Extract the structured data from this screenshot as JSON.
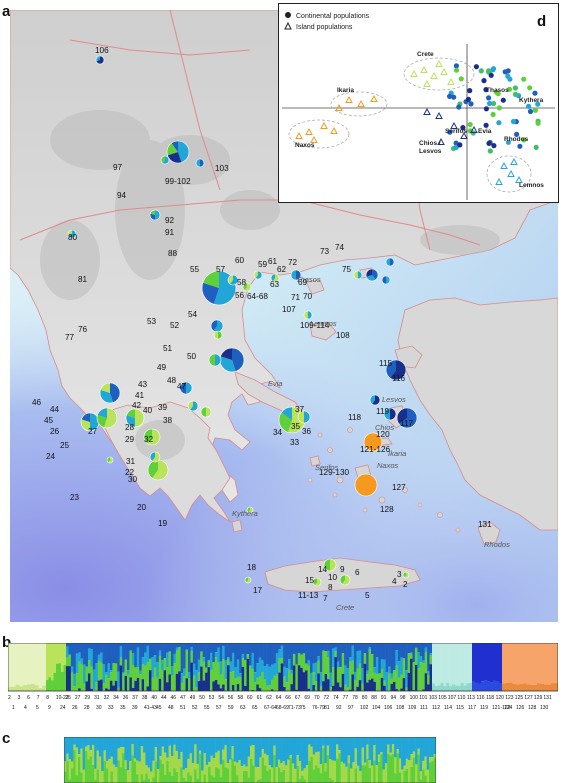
{
  "panels": {
    "a": "a",
    "b": "b",
    "c": "c",
    "d": "d"
  },
  "colors": {
    "sea_deep": "#7f8fe0",
    "sea_light": "#cde9f6",
    "land": "#dedede",
    "border": "#e08a8a",
    "blue": "#1f5fbf",
    "navy": "#1a2f8a",
    "cyan": "#22a6d8",
    "green": "#5fcf3a",
    "lime": "#b8e35a",
    "orange": "#f59a1e",
    "teal": "#7fd6c8"
  },
  "inset": {
    "legend_continental": "Continental populations",
    "legend_island": "Island populations",
    "labels": [
      "Crete",
      "Ikaria",
      "Naxos",
      "Thasos",
      "Kythera",
      "Serifos",
      "Evia",
      "Chios /",
      "Lesvos",
      "Rhodos",
      "Lemnos"
    ]
  },
  "map_labels": {
    "pop_numbers": [
      {
        "t": "106"
      },
      {
        "t": "97"
      },
      {
        "t": "99-102"
      },
      {
        "t": "103"
      },
      {
        "t": "94"
      },
      {
        "t": "92"
      },
      {
        "t": "91"
      },
      {
        "t": "88"
      },
      {
        "t": "80"
      },
      {
        "t": "81"
      },
      {
        "t": "77"
      },
      {
        "t": "76"
      },
      {
        "t": "46"
      },
      {
        "t": "45"
      },
      {
        "t": "44"
      },
      {
        "t": "26"
      },
      {
        "t": "27"
      },
      {
        "t": "25"
      },
      {
        "t": "24"
      },
      {
        "t": "23"
      },
      {
        "t": "28"
      },
      {
        "t": "29"
      },
      {
        "t": "32"
      },
      {
        "t": "22"
      },
      {
        "t": "31"
      },
      {
        "t": "30"
      },
      {
        "t": "20"
      },
      {
        "t": "19"
      },
      {
        "t": "43"
      },
      {
        "t": "42"
      },
      {
        "t": "41"
      },
      {
        "t": "40"
      },
      {
        "t": "39"
      },
      {
        "t": "38"
      },
      {
        "t": "47"
      },
      {
        "t": "48"
      },
      {
        "t": "49"
      },
      {
        "t": "50"
      },
      {
        "t": "51"
      },
      {
        "t": "52"
      },
      {
        "t": "53"
      },
      {
        "t": "54"
      },
      {
        "t": "55"
      },
      {
        "t": "56"
      },
      {
        "t": "57"
      },
      {
        "t": "58"
      },
      {
        "t": "59"
      },
      {
        "t": "60"
      },
      {
        "t": "61"
      },
      {
        "t": "62"
      },
      {
        "t": "63"
      },
      {
        "t": "64-68"
      },
      {
        "t": "69"
      },
      {
        "t": "70"
      },
      {
        "t": "71"
      },
      {
        "t": "72"
      },
      {
        "t": "73"
      },
      {
        "t": "74"
      },
      {
        "t": "75"
      },
      {
        "t": "107"
      },
      {
        "t": "108"
      },
      {
        "t": "109-114"
      },
      {
        "t": "115"
      },
      {
        "t": "116"
      },
      {
        "t": "117"
      },
      {
        "t": "118"
      },
      {
        "t": "119"
      },
      {
        "t": "120"
      },
      {
        "t": "121-126"
      },
      {
        "t": "127"
      },
      {
        "t": "128"
      },
      {
        "t": "129-130"
      },
      {
        "t": "131"
      },
      {
        "t": "37"
      },
      {
        "t": "34"
      },
      {
        "t": "35"
      },
      {
        "t": "36"
      },
      {
        "t": "33"
      },
      {
        "t": "18"
      },
      {
        "t": "17"
      },
      {
        "t": "14"
      },
      {
        "t": "15"
      },
      {
        "t": "10"
      },
      {
        "t": "9"
      },
      {
        "t": "8"
      },
      {
        "t": "7"
      },
      {
        "t": "6"
      },
      {
        "t": "11-13"
      },
      {
        "t": "5"
      },
      {
        "t": "3"
      },
      {
        "t": "2"
      },
      {
        "t": "4"
      }
    ],
    "place_names": [
      {
        "t": "Thasos"
      },
      {
        "t": "Lemnos"
      },
      {
        "t": "Lesvos"
      },
      {
        "t": "Evia"
      },
      {
        "t": "Chios"
      },
      {
        "t": "Ikaria"
      },
      {
        "t": "Serifos"
      },
      {
        "t": "Naxos"
      },
      {
        "t": "Kythera"
      },
      {
        "t": "Rhodos"
      },
      {
        "t": "Crete"
      }
    ]
  },
  "strip_b_labels": {
    "top": [
      "2",
      "3",
      "6",
      "7",
      "8",
      "10-23",
      "25",
      "27",
      "29",
      "31",
      "32",
      "34",
      "36",
      "37",
      "38",
      "40",
      "44",
      "46",
      "47",
      "49",
      "50",
      "53",
      "54",
      "56",
      "58",
      "60",
      "61",
      "62",
      "64",
      "66",
      "67",
      "69",
      "70",
      "72",
      "74",
      "77",
      "78",
      "80",
      "88",
      "91",
      "94",
      "98",
      "100",
      "101",
      "103",
      "105",
      "107",
      "110",
      "113",
      "116",
      "118",
      "120",
      "123",
      "125",
      "127",
      "129",
      "131"
    ],
    "bottom": [
      "1",
      "4",
      "5",
      "9",
      "24",
      "26",
      "28",
      "30",
      "33",
      "35",
      "39",
      "41-43",
      "45",
      "48",
      "51",
      "52",
      "55",
      "57",
      "59",
      "63",
      "65",
      "67-64",
      "68-69",
      "71-73",
      "75",
      "76-79",
      "81",
      "92",
      "97",
      "102",
      "104",
      "106",
      "108",
      "109",
      "111",
      "112",
      "114",
      "115",
      "117",
      "119",
      "121-122",
      "124",
      "126",
      "128",
      "130"
    ]
  },
  "strip_c": {}
}
